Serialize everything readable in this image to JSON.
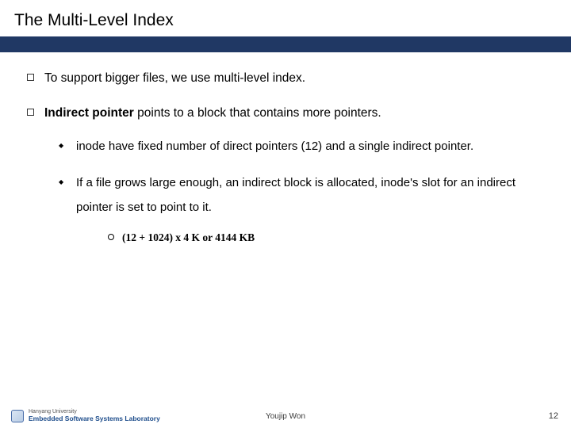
{
  "title": "The Multi-Level Index",
  "points": {
    "p1": "To support bigger files, we use multi-level index.",
    "p2_bold": "Indirect pointer",
    "p2_rest": " points to a block that contains more pointers.",
    "sub1": "inode have fixed number of direct pointers (12) and a single indirect pointer.",
    "sub2": "If a file grows large enough, an indirect block is allocated, inode's slot for an indirect pointer is set to point to it.",
    "sub2a": "(12 + 1024) x 4 K or 4144 KB"
  },
  "footer": {
    "university": "Hanyang University",
    "lab": "Embedded Software Systems Laboratory",
    "author": "Youjip Won",
    "page": "12"
  }
}
